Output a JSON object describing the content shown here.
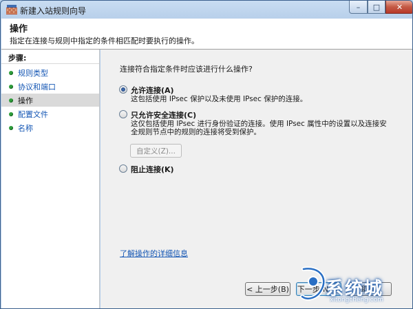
{
  "window": {
    "title": "新建入站规则向导",
    "controls": {
      "minimize": "–",
      "maximize": "□",
      "close": "✕"
    }
  },
  "header": {
    "title": "操作",
    "description": "指定在连接与规则中指定的条件相匹配时要执行的操作。"
  },
  "sidebar": {
    "heading": "步骤:",
    "items": [
      {
        "label": "规则类型",
        "active": false
      },
      {
        "label": "协议和端口",
        "active": false
      },
      {
        "label": "操作",
        "active": true
      },
      {
        "label": "配置文件",
        "active": false
      },
      {
        "label": "名称",
        "active": false
      }
    ]
  },
  "main": {
    "question": "连接符合指定条件时应该进行什么操作?",
    "options": [
      {
        "label": "允许连接(A)",
        "checked": true,
        "description": [
          "这包括使用 IPsec 保护以及未使用 IPsec 保护的连接。"
        ]
      },
      {
        "label": "只允许安全连接(C)",
        "checked": false,
        "description": [
          "这仅包括使用 IPsec 进行身份验证的连接。使用 IPsec 属性中的设置以及连接安",
          "全规则节点中的规则的连接将受到保护。"
        ]
      },
      {
        "label": "阻止连接(K)",
        "checked": false,
        "description": []
      }
    ],
    "customize_label": "自定义(Z)...",
    "learn_link": "了解操作的详细信息"
  },
  "footer": {
    "back_label": "< 上一步(B)",
    "next_label": "下一步(N) >",
    "cancel_label": "取消"
  },
  "watermark": {
    "text": "系统城",
    "sub": "xitongcheng.com"
  }
}
